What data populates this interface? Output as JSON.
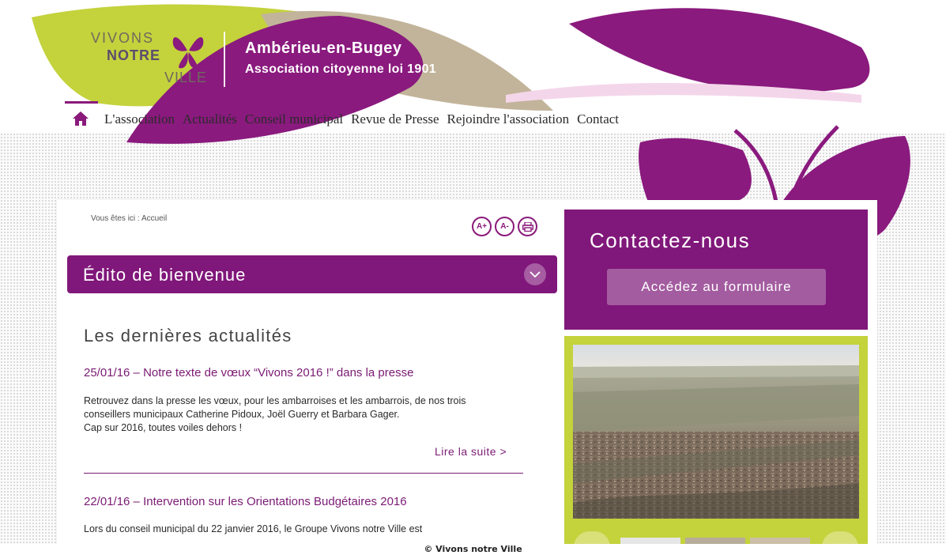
{
  "header": {
    "logo": {
      "line1": "VIVONS",
      "line2": "NOTRE",
      "line3": "VILLE"
    },
    "city": "Ambérieu-en-Bugey",
    "subtitle": "Association citoyenne loi 1901"
  },
  "nav": {
    "home_icon": "home-icon",
    "items": [
      "L'association",
      "Actualités",
      "Conseil municipal",
      "Revue de Presse",
      "Rejoindre l'association",
      "Contact"
    ]
  },
  "breadcrumb": {
    "prefix": "Vous êtes ici :",
    "current": "Accueil"
  },
  "tools": {
    "increase": "A+",
    "decrease": "A-",
    "print_icon": "print-icon"
  },
  "edito": {
    "title": "Édito de bienvenue",
    "toggle_icon": "chevron-down-icon"
  },
  "news": {
    "title": "Les dernières actualités",
    "articles": [
      {
        "title": "25/01/16 – Notre texte de vœux “Vivons 2016 !” dans la presse",
        "body_lines": [
          "Retrouvez dans la presse les vœux, pour les ambarroises et les ambarrois, de nos trois",
          "conseillers municipaux Catherine Pidoux, Joël Guerry et Barbara Gager.",
          "Cap sur 2016, toutes voiles dehors !"
        ],
        "more": "Lire la suite >"
      },
      {
        "title": "22/01/16 – Intervention sur les Orientations Budgétaires 2016",
        "body_lines": [
          "Lors du conseil municipal du 22 janvier 2016, le Groupe Vivons notre Ville est"
        ]
      }
    ]
  },
  "sidebar": {
    "contact_title": "Contactez-nous",
    "contact_button": "Accédez au formulaire"
  },
  "footer": {
    "copyright": "© Vivons notre Ville"
  },
  "colors": {
    "purple": "#80177a",
    "lime": "#c4d23c",
    "beige": "#c2b49a"
  }
}
